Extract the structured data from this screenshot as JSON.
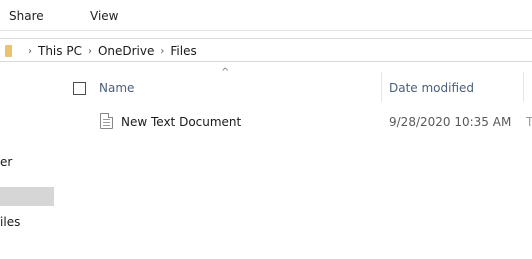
{
  "ribbon": {
    "tabs": [
      {
        "label": "Share"
      },
      {
        "label": "View"
      }
    ]
  },
  "address": {
    "crumbs": [
      "This PC",
      "OneDrive",
      "Files"
    ],
    "separator": "›"
  },
  "nav": {
    "items": [
      "er",
      "",
      "Files"
    ]
  },
  "header": {
    "sort_glyph": "^",
    "name_label": "Name",
    "date_label": "Date modified"
  },
  "files": [
    {
      "name": "New Text Document",
      "date_modified": "9/28/2020 10:35 AM",
      "extra": "T"
    }
  ],
  "colors": {
    "header_text": "#4c607a",
    "selected_nav": "#d6d6d6",
    "folder": "#e9c46a"
  }
}
